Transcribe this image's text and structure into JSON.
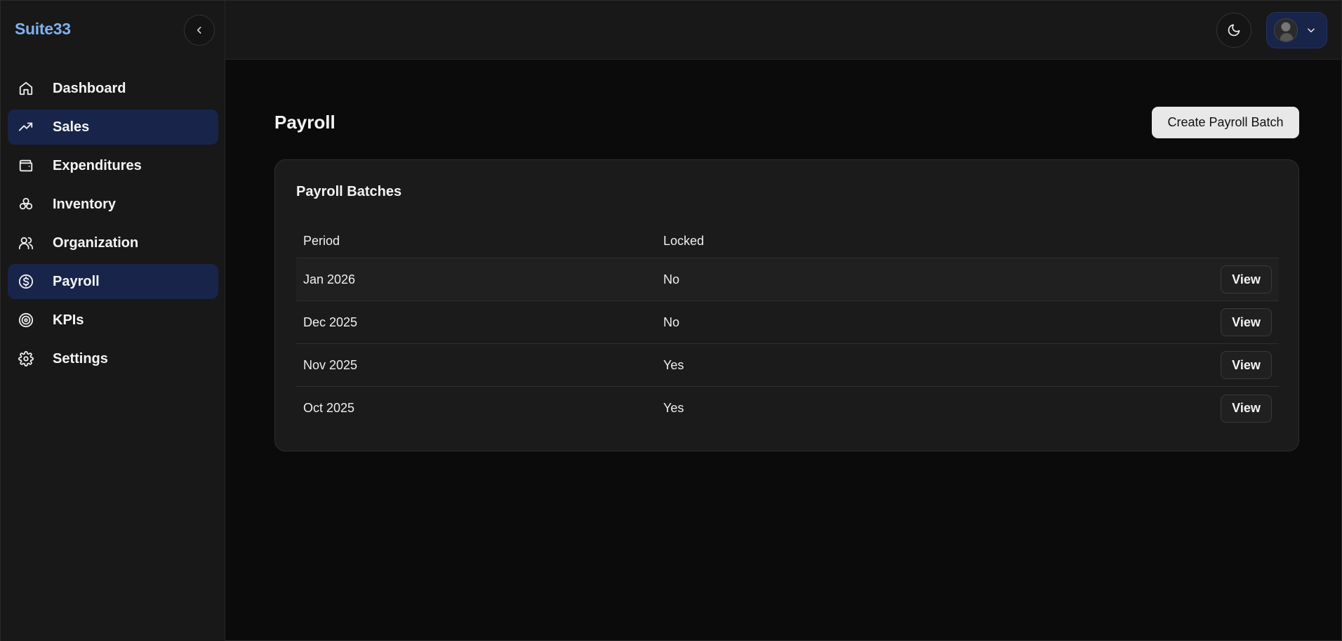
{
  "app": {
    "brand": "Suite33"
  },
  "sidebar": {
    "items": [
      {
        "label": "Dashboard",
        "icon": "home-icon",
        "active": false
      },
      {
        "label": "Sales",
        "icon": "trending-up-icon",
        "active": true
      },
      {
        "label": "Expenditures",
        "icon": "wallet-icon",
        "active": false
      },
      {
        "label": "Inventory",
        "icon": "boxes-icon",
        "active": false
      },
      {
        "label": "Organization",
        "icon": "users-icon",
        "active": false
      },
      {
        "label": "Payroll",
        "icon": "dollar-circle-icon",
        "active": true
      },
      {
        "label": "KPIs",
        "icon": "target-icon",
        "active": false
      },
      {
        "label": "Settings",
        "icon": "gear-icon",
        "active": false
      }
    ]
  },
  "topbar": {
    "theme_icon": "moon-icon",
    "user_icon": "avatar",
    "menu_icon": "chevron-down-icon"
  },
  "main": {
    "title": "Payroll",
    "create_button": "Create Payroll Batch",
    "card": {
      "title": "Payroll Batches",
      "columns": [
        "Period",
        "Locked"
      ],
      "rows": [
        {
          "period": "Jan 2026",
          "locked": "No",
          "action": "View"
        },
        {
          "period": "Dec 2025",
          "locked": "No",
          "action": "View"
        },
        {
          "period": "Nov 2025",
          "locked": "Yes",
          "action": "View"
        },
        {
          "period": "Oct 2025",
          "locked": "Yes",
          "action": "View"
        }
      ]
    }
  },
  "colors": {
    "brand": "#7fb2ee",
    "active_nav_bg": "#18244a",
    "primary_button_bg": "#e8e8e8"
  }
}
